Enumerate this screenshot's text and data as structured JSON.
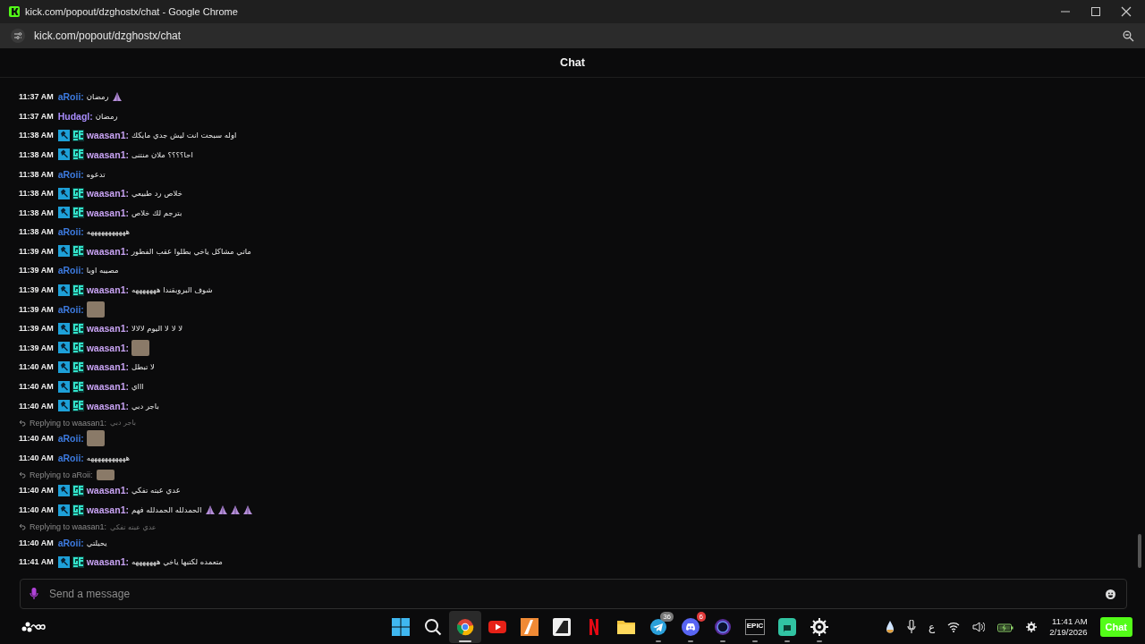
{
  "window": {
    "title": "kick.com/popout/dzghostx/chat - Google Chrome",
    "url": "kick.com/popout/dzghostx/chat"
  },
  "chat": {
    "title": "Chat",
    "messages": [
      {
        "time": "11:37 AM",
        "user": "aRoii:",
        "color": "#3d7be0",
        "text": "رمضان",
        "emotes": [
          {
            "kind": "pray"
          }
        ]
      },
      {
        "time": "11:37 AM",
        "user": "Hudagl:",
        "color": "#a78bfa",
        "text": "رمضان"
      },
      {
        "time": "11:38 AM",
        "user": "waasan1:",
        "color": "#c7a2f2",
        "badges": [
          {
            "kind": "moderator"
          },
          {
            "kind": "og"
          }
        ],
        "text": "اوله سبحت انت ليش جدي مايكك"
      },
      {
        "time": "11:38 AM",
        "user": "waasan1:",
        "color": "#c7a2f2",
        "badges": [
          {
            "kind": "moderator"
          },
          {
            "kind": "og"
          }
        ],
        "text": "احا؟؟؟؟ ملان منتنى"
      },
      {
        "time": "11:38 AM",
        "user": "aRoii:",
        "color": "#3d7be0",
        "text": "تدعوه"
      },
      {
        "time": "11:38 AM",
        "user": "waasan1:",
        "color": "#c7a2f2",
        "badges": [
          {
            "kind": "moderator"
          },
          {
            "kind": "og"
          }
        ],
        "text": "خلاص رد طبيعي"
      },
      {
        "time": "11:38 AM",
        "user": "waasan1:",
        "color": "#c7a2f2",
        "badges": [
          {
            "kind": "moderator"
          },
          {
            "kind": "og"
          }
        ],
        "text": "بترجم لك خلاص"
      },
      {
        "time": "11:38 AM",
        "user": "aRoii:",
        "color": "#3d7be0",
        "text": "هههههههههههه"
      },
      {
        "time": "11:39 AM",
        "user": "waasan1:",
        "color": "#c7a2f2",
        "badges": [
          {
            "kind": "moderator"
          },
          {
            "kind": "og"
          }
        ],
        "text": "ماتي مشاكل ياخي بطلوا عقب الفطور"
      },
      {
        "time": "11:39 AM",
        "user": "aRoii:",
        "color": "#3d7be0",
        "text": "مصيبه اوبا"
      },
      {
        "time": "11:39 AM",
        "user": "waasan1:",
        "color": "#c7a2f2",
        "badges": [
          {
            "kind": "moderator"
          },
          {
            "kind": "og"
          }
        ],
        "text": "شوف البروبقندا هههههههه"
      },
      {
        "time": "11:39 AM",
        "user": "aRoii:",
        "color": "#3d7be0",
        "emotes": [
          {
            "kind": "image"
          }
        ]
      },
      {
        "time": "11:39 AM",
        "user": "waasan1:",
        "color": "#c7a2f2",
        "badges": [
          {
            "kind": "moderator"
          },
          {
            "kind": "og"
          }
        ],
        "text": "لا لا لا اليوم لالالا"
      },
      {
        "time": "11:39 AM",
        "user": "waasan1:",
        "color": "#c7a2f2",
        "badges": [
          {
            "kind": "moderator"
          },
          {
            "kind": "og"
          }
        ],
        "emotes": [
          {
            "kind": "image"
          }
        ]
      },
      {
        "time": "11:40 AM",
        "user": "waasan1:",
        "color": "#c7a2f2",
        "badges": [
          {
            "kind": "moderator"
          },
          {
            "kind": "og"
          }
        ],
        "text": "لا تبطل"
      },
      {
        "time": "11:40 AM",
        "user": "waasan1:",
        "color": "#c7a2f2",
        "badges": [
          {
            "kind": "moderator"
          },
          {
            "kind": "og"
          }
        ],
        "text": "اااي"
      },
      {
        "time": "11:40 AM",
        "user": "waasan1:",
        "color": "#c7a2f2",
        "badges": [
          {
            "kind": "moderator"
          },
          {
            "kind": "og"
          }
        ],
        "text": "باجر دبي"
      },
      {
        "reply": {
          "label": "Replying to waasan1:",
          "text": "باجر دبي"
        },
        "time": "11:40 AM",
        "user": "aRoii:",
        "color": "#3d7be0",
        "emotes": [
          {
            "kind": "image"
          }
        ]
      },
      {
        "time": "11:40 AM",
        "user": "aRoii:",
        "color": "#3d7be0",
        "text": "هههههههههههه"
      },
      {
        "reply": {
          "label": "Replying to aRoii:",
          "emote": true
        },
        "time": "11:40 AM",
        "user": "waasan1:",
        "color": "#c7a2f2",
        "badges": [
          {
            "kind": "moderator"
          },
          {
            "kind": "og"
          }
        ],
        "text": "عدي عبته تفكي"
      },
      {
        "time": "11:40 AM",
        "user": "waasan1:",
        "color": "#c7a2f2",
        "badges": [
          {
            "kind": "moderator"
          },
          {
            "kind": "og"
          }
        ],
        "text": "الحمدلله الحمدلله فهم",
        "emotes": [
          {
            "kind": "pray"
          },
          {
            "kind": "pray"
          },
          {
            "kind": "pray"
          },
          {
            "kind": "pray"
          }
        ]
      },
      {
        "reply": {
          "label": "Replying to waasan1:",
          "text": "عدي عبته تفكي"
        },
        "time": "11:40 AM",
        "user": "aRoii:",
        "color": "#3d7be0",
        "text": "يحيلتي"
      },
      {
        "time": "11:41 AM",
        "user": "waasan1:",
        "color": "#c7a2f2",
        "badges": [
          {
            "kind": "moderator"
          },
          {
            "kind": "og"
          }
        ],
        "text": "متعمده لكتبها ياخي هههههههه"
      }
    ],
    "input": {
      "placeholder": "Send a message"
    }
  },
  "taskbar": {
    "apps": [
      {
        "kind": "start",
        "selected": false
      },
      {
        "kind": "search",
        "selected": false
      },
      {
        "kind": "chrome",
        "selected": true,
        "running": true
      },
      {
        "kind": "youtube",
        "selected": false
      },
      {
        "kind": "orange",
        "selected": false
      },
      {
        "kind": "dark",
        "selected": false
      },
      {
        "kind": "netflix",
        "selected": false
      },
      {
        "kind": "folder",
        "selected": false
      },
      {
        "kind": "telegram",
        "selected": false,
        "running": true,
        "count": "36"
      },
      {
        "kind": "discord",
        "selected": false,
        "running": true,
        "count": "6"
      },
      {
        "kind": "ring",
        "selected": false,
        "running": true
      },
      {
        "kind": "epic",
        "selected": false,
        "running": true,
        "label": "EPIC"
      },
      {
        "kind": "streamlabs",
        "selected": false,
        "running": true
      },
      {
        "kind": "steelseries",
        "selected": false,
        "running": true
      }
    ],
    "language": "ع",
    "clock": {
      "time": "11:41 AM",
      "date": "2/19/2026"
    },
    "overlay": "Chat"
  }
}
